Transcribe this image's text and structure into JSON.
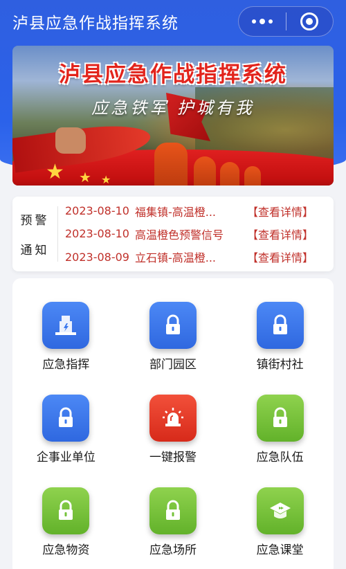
{
  "header": {
    "title": "泸县应急作战指挥系统"
  },
  "banner": {
    "title": "泸县应急作战指挥系统",
    "slogan": "应急铁军  护城有我"
  },
  "notice": {
    "label_top": "预警",
    "label_bottom": "通知",
    "items": [
      {
        "date": "2023-08-10",
        "text": "福集镇-高温橙...",
        "more": "【查看详情】"
      },
      {
        "date": "2023-08-10",
        "text": "高温橙色预警信号",
        "more": "【查看详情】"
      },
      {
        "date": "2023-08-09",
        "text": "立石镇-高温橙...",
        "more": "【查看详情】"
      }
    ]
  },
  "tiles": [
    {
      "label": "应急指挥",
      "icon": "building-icon",
      "color": "#3b78ee"
    },
    {
      "label": "部门园区",
      "icon": "lock-icon",
      "color": "#3b78ee"
    },
    {
      "label": "镇街村社",
      "icon": "lock-icon",
      "color": "#3b78ee"
    },
    {
      "label": "企事业单位",
      "icon": "lock-icon",
      "color": "#3b78ee"
    },
    {
      "label": "一键报警",
      "icon": "siren-icon",
      "color": "#e23b28"
    },
    {
      "label": "应急队伍",
      "icon": "lock-icon",
      "color": "#74c23a"
    },
    {
      "label": "应急物资",
      "icon": "lock-icon",
      "color": "#74c23a"
    },
    {
      "label": "应急场所",
      "icon": "lock-icon",
      "color": "#74c23a"
    },
    {
      "label": "应急课堂",
      "icon": "graduation-cap-icon",
      "color": "#74c23a"
    }
  ]
}
